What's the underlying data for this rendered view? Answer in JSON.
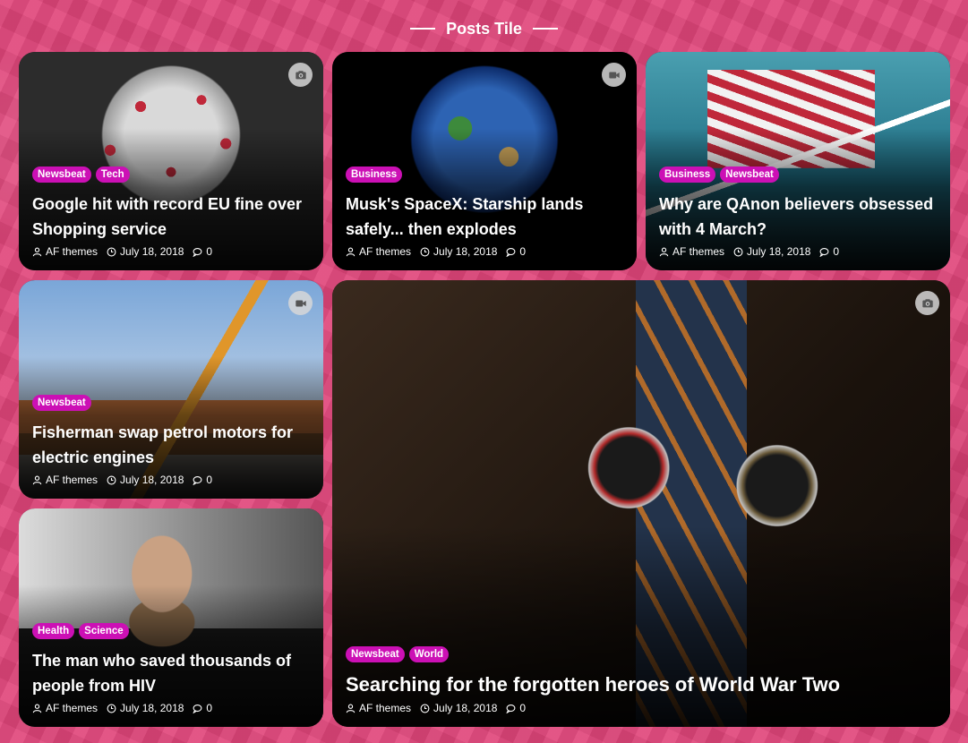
{
  "section": {
    "title": "Posts Tile"
  },
  "meta_icons": {
    "author": "user-icon",
    "date": "clock-icon",
    "comments": "comment-icon"
  },
  "colors": {
    "background": "#e0457a",
    "category_badge": "#cc10b5"
  },
  "posts": [
    {
      "title": "Google hit with record EU fine over Shopping service",
      "categories": [
        "Newsbeat",
        "Tech"
      ],
      "author": "AF themes",
      "date": "July 18, 2018",
      "comments": "0",
      "media": "camera-icon"
    },
    {
      "title": "Musk's SpaceX: Starship lands safely... then explodes",
      "categories": [
        "Business"
      ],
      "author": "AF themes",
      "date": "July 18, 2018",
      "comments": "0",
      "media": "video-icon"
    },
    {
      "title": "Why are QAnon believers obsessed with 4 March?",
      "categories": [
        "Business",
        "Newsbeat"
      ],
      "author": "AF themes",
      "date": "July 18, 2018",
      "comments": "0",
      "media": ""
    },
    {
      "title": "Fisherman swap petrol motors for electric engines",
      "categories": [
        "Newsbeat"
      ],
      "author": "AF themes",
      "date": "July 18, 2018",
      "comments": "0",
      "media": "video-icon"
    },
    {
      "title": "Searching for the forgotten heroes of World War Two",
      "categories": [
        "Newsbeat",
        "World"
      ],
      "author": "AF themes",
      "date": "July 18, 2018",
      "comments": "0",
      "media": "camera-icon"
    },
    {
      "title": "The man who saved thousands of people from HIV",
      "categories": [
        "Health",
        "Science"
      ],
      "author": "AF themes",
      "date": "July 18, 2018",
      "comments": "0",
      "media": ""
    }
  ]
}
